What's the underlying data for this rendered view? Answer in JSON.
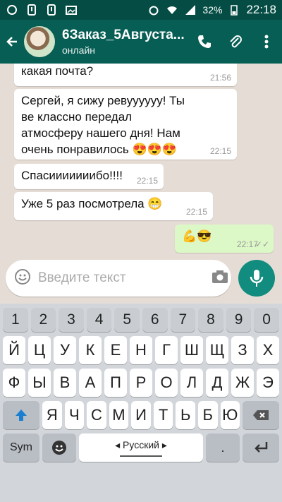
{
  "status": {
    "battery": "32%",
    "time": "22:18"
  },
  "header": {
    "title": "6Заказ_5Августа...",
    "subtitle": "онлайн"
  },
  "messages": [
    {
      "text": "какая почта?",
      "time": "21:56",
      "direction": "in"
    },
    {
      "text": "Сергей, я сижу ревуууууу! Ты ве классно передал атмосферу нашего дня! Нам очень понравилось 😍😍😍",
      "time": "22:15",
      "direction": "in"
    },
    {
      "text": "Спасииииииибо!!!!",
      "time": "22:15",
      "direction": "in"
    },
    {
      "text": "Уже 5 раз посмотрела 😁",
      "time": "22:15",
      "direction": "in"
    },
    {
      "text": "💪😎",
      "time": "22:17",
      "direction": "out"
    }
  ],
  "composer": {
    "placeholder": "Введите текст"
  },
  "keyboard": {
    "numbers": [
      "1",
      "2",
      "3",
      "4",
      "5",
      "6",
      "7",
      "8",
      "9",
      "0"
    ],
    "row1": [
      "Й",
      "Ц",
      "У",
      "К",
      "Е",
      "Н",
      "Г",
      "Ш",
      "Щ",
      "З",
      "Х"
    ],
    "row2": [
      "Ф",
      "Ы",
      "В",
      "А",
      "П",
      "Р",
      "О",
      "Л",
      "Д",
      "Ж",
      "Э"
    ],
    "row3": [
      "Я",
      "Ч",
      "С",
      "М",
      "И",
      "Т",
      "Ь",
      "Б",
      "Ю"
    ],
    "sym_label": "Sym",
    "space_label": "◂ Русский ▸"
  },
  "colors": {
    "header_bg": "#075e54",
    "status_bg": "#054d44",
    "accent": "#128c7e",
    "outgoing_bubble": "#dcf8c6"
  }
}
